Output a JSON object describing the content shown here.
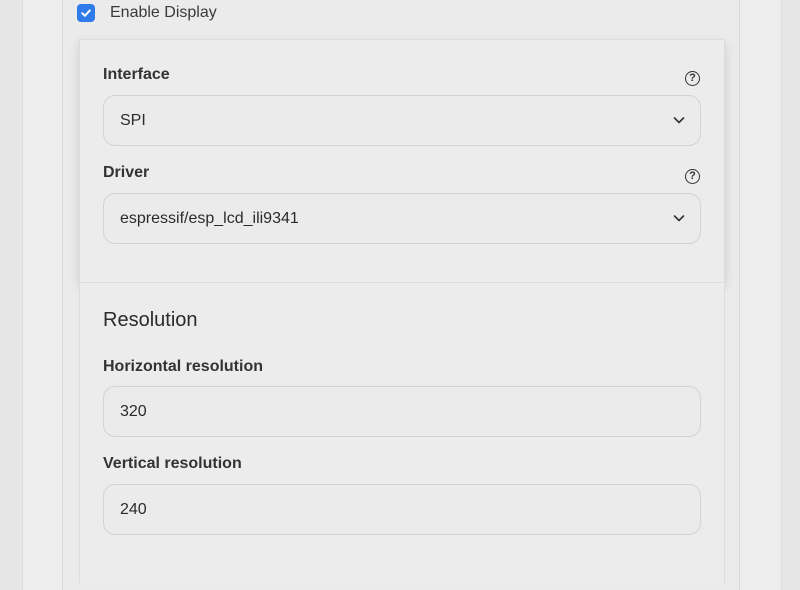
{
  "enable_display": {
    "label": "Enable Display",
    "checked": true
  },
  "interface": {
    "label": "Interface",
    "help_icon": "question-circle-icon",
    "value": "SPI"
  },
  "driver": {
    "label": "Driver",
    "help_icon": "question-circle-icon",
    "value": "espressif/esp_lcd_ili9341"
  },
  "resolution": {
    "title": "Resolution",
    "horizontal": {
      "label": "Horizontal resolution",
      "value": "320"
    },
    "vertical": {
      "label": "Vertical resolution",
      "value": "240"
    }
  },
  "colors": {
    "accent": "#2f7bea",
    "background": "#e6e6e6"
  }
}
